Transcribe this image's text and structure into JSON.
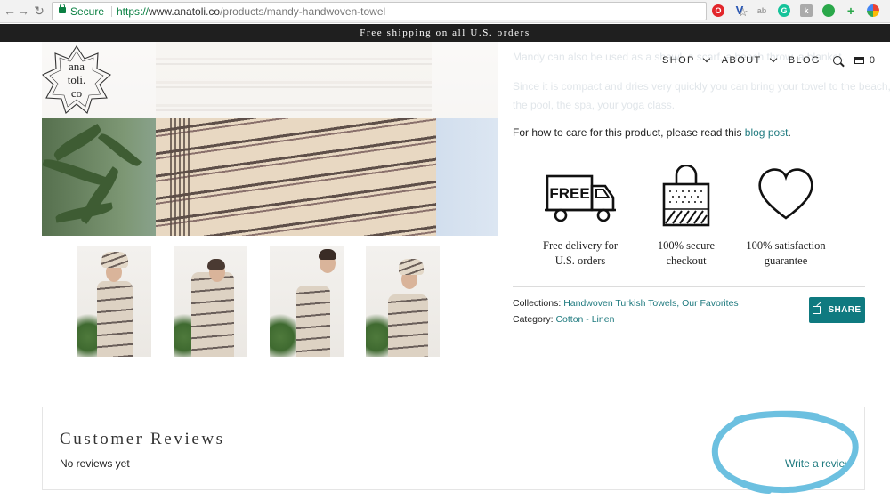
{
  "browser": {
    "secure_label": "Secure",
    "url_protocol": "https://",
    "url_host": "www.anatoli.co",
    "url_path": "/products/mandy-handwoven-towel"
  },
  "announcement": {
    "text": "Free shipping on all U.S. orders"
  },
  "logo": {
    "line1": "ana",
    "line2": "toli.",
    "line3": "co"
  },
  "nav": {
    "items": [
      {
        "label": "SHOP",
        "has_dropdown": true
      },
      {
        "label": "ABOUT",
        "has_dropdown": true
      },
      {
        "label": "BLOG",
        "has_dropdown": false
      }
    ],
    "cart_count": "0"
  },
  "description": {
    "faded_line1": "Mandy can also be used as a shawl, a scarf, a beach throw, a blanket.",
    "faded_line2": "Since it is compact and dries very quickly you can bring your towel to the beach,",
    "faded_line3": "the pool, the spa, your yoga class.",
    "care_prefix": "For how to care for this product, please read this ",
    "care_link": "blog post",
    "care_suffix": "."
  },
  "features": [
    {
      "icon": "delivery-truck-icon",
      "badge": "FREE",
      "line1": "Free delivery for",
      "line2": "U.S. orders"
    },
    {
      "icon": "secure-bag-icon",
      "line1": "100% secure",
      "line2": "checkout"
    },
    {
      "icon": "heart-icon",
      "line1": "100% satisfaction",
      "line2": "guarantee"
    }
  ],
  "meta": {
    "collections_label": "Collections: ",
    "collections_links": "Handwoven Turkish Towels, Our Favorites",
    "category_label": "Category: ",
    "category_link": "Cotton - Linen"
  },
  "share": {
    "label": "SHARE"
  },
  "reviews": {
    "title": "Customer Reviews",
    "empty_text": "No reviews yet",
    "write_label": "Write a review"
  },
  "colors": {
    "accent": "#0f7a80",
    "link": "#1f7a7f",
    "announcement_bg": "#1f1f1f",
    "annotation": "#6cc0e0"
  }
}
